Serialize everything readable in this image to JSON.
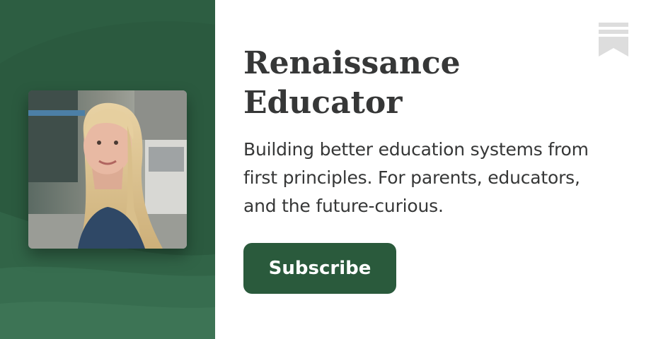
{
  "publication": {
    "title_line1": "Renaissance",
    "title_line2": "Educator",
    "description_line1": "Building better education systems from",
    "description_line2": "first principles. For parents, educators,",
    "description_line3": "and the future-curious."
  },
  "actions": {
    "subscribe_label": "Subscribe"
  },
  "icons": {
    "logo": "bookmark-icon",
    "avatar": "author-photo"
  },
  "colors": {
    "panel_green": "#2b5a3f",
    "button_green": "#2a5a3c",
    "text": "#363737",
    "logo_gray": "#dddddd"
  }
}
